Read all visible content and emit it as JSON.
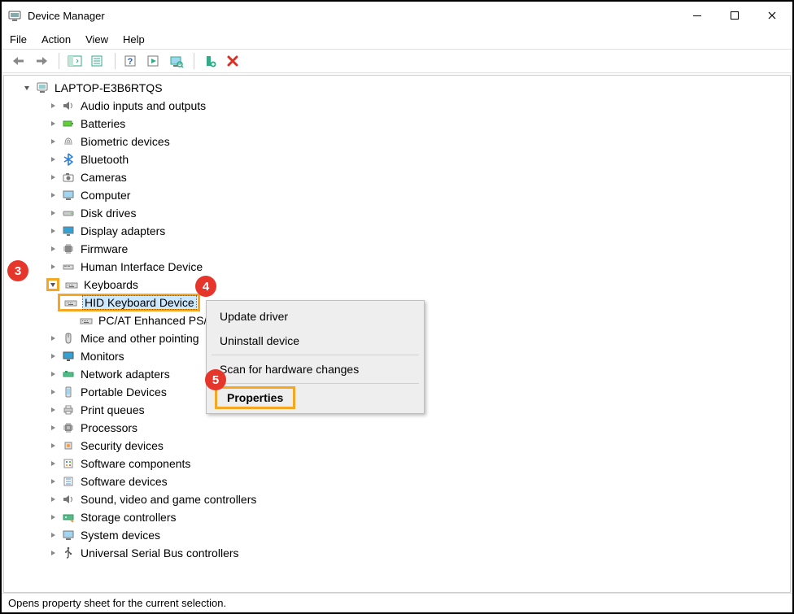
{
  "window": {
    "title": "Device Manager"
  },
  "menu": {
    "file": "File",
    "action": "Action",
    "view": "View",
    "help": "Help"
  },
  "tree": {
    "root": "LAPTOP-E3B6RTQS",
    "categories": [
      "Audio inputs and outputs",
      "Batteries",
      "Biometric devices",
      "Bluetooth",
      "Cameras",
      "Computer",
      "Disk drives",
      "Display adapters",
      "Firmware",
      "Human Interface Device",
      "Keyboards",
      "Mice and other pointing",
      "Monitors",
      "Network adapters",
      "Portable Devices",
      "Print queues",
      "Processors",
      "Security devices",
      "Software components",
      "Software devices",
      "Sound, video and game controllers",
      "Storage controllers",
      "System devices",
      "Universal Serial Bus controllers"
    ],
    "keyboard_children": [
      "HID Keyboard Device",
      "PC/AT Enhanced PS/2"
    ]
  },
  "context_menu": {
    "update_driver": "Update driver",
    "uninstall_device": "Uninstall device",
    "scan_hardware": "Scan for hardware changes",
    "properties": "Properties"
  },
  "status": "Opens property sheet for the current selection.",
  "annotations": {
    "b3": "3",
    "b4": "4",
    "b5": "5"
  }
}
